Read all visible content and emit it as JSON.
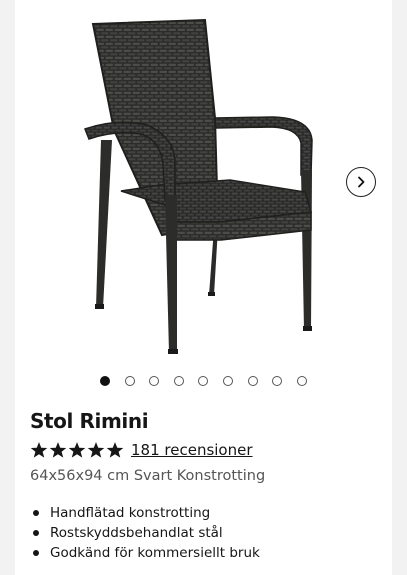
{
  "product": {
    "title": "Stol Rimini",
    "rating": 5,
    "rating_max": 5,
    "reviews_label": "181 recensioner",
    "variant": "64x56x94 cm Svart Konstrotting",
    "features": [
      "Handflätad konstrotting",
      "Rostskyddsbehandlat stål",
      "Godkänd för kommersiellt bruk"
    ]
  },
  "gallery": {
    "image_count": 9,
    "active_index": 0,
    "next_icon": "chevron-right-icon",
    "image_subject": "chair"
  },
  "colors": {
    "star": "#161616",
    "chair": "#2e2e2c",
    "page_bg": "#f2f2f2"
  }
}
